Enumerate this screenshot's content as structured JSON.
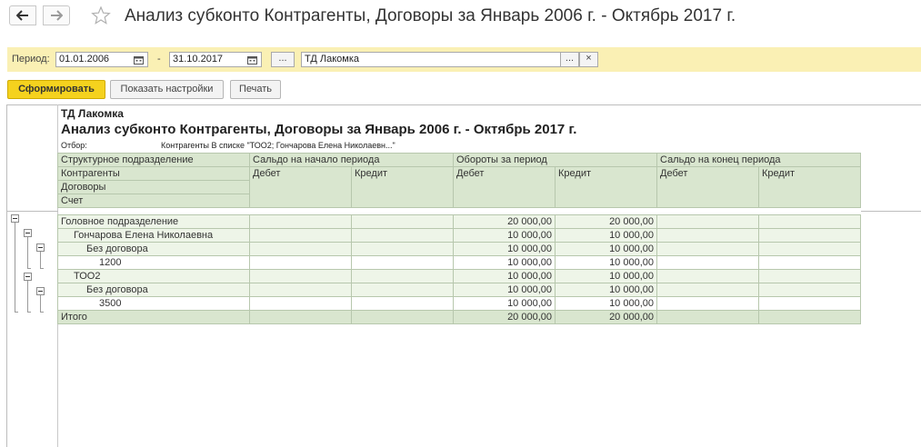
{
  "window": {
    "title": "Анализ субконто Контрагенты, Договоры  за Январь 2006 г. - Октябрь 2017 г.",
    "back_icon": "arrow-left-icon",
    "forward_icon": "arrow-right-icon",
    "favorite_icon": "star-icon"
  },
  "period_panel": {
    "label": "Период:",
    "date_from": "01.01.2006",
    "separator": "-",
    "date_to": "31.10.2017",
    "select_label": "...",
    "organization": "ТД Лакомка",
    "org_select_label": "...",
    "org_clear_label": "×",
    "calendar_icon": "calendar-icon",
    "background": "#faf0b4"
  },
  "toolbar": {
    "form_label": "Сформировать",
    "settings_label": "Показать настройки",
    "print_label": "Печать",
    "accent": "#f5d21e"
  },
  "report": {
    "organization": "ТД Лакомка",
    "title": "Анализ субконто Контрагенты, Договоры  за Январь 2006 г. - Октябрь 2017 г.",
    "filter_label": "Отбор:",
    "filter_value": "Контрагенты В списке \"ТОО2; Гончарова Елена Николаевн...\"",
    "header": {
      "dim1": "Структурное подразделение",
      "dim2": "Контрагенты",
      "dim3": "Договоры",
      "dim4": "Счет",
      "opening": "Сальдо на начало периода",
      "turnover": "Обороты за период",
      "closing": "Сальдо на конец периода",
      "debit": "Дебет",
      "credit": "Кредит"
    },
    "rows": [
      {
        "name": "Головное подразделение",
        "od": "",
        "oc": "",
        "td": "20 000,00",
        "tc": "20 000,00",
        "cd": "",
        "cc": ""
      },
      {
        "name": "Гончарова Елена Николаевна",
        "od": "",
        "oc": "",
        "td": "10 000,00",
        "tc": "10 000,00",
        "cd": "",
        "cc": ""
      },
      {
        "name": "Без договора",
        "od": "",
        "oc": "",
        "td": "10 000,00",
        "tc": "10 000,00",
        "cd": "",
        "cc": ""
      },
      {
        "name": "1200",
        "od": "",
        "oc": "",
        "td": "10 000,00",
        "tc": "10 000,00",
        "cd": "",
        "cc": ""
      },
      {
        "name": "ТОО2",
        "od": "",
        "oc": "",
        "td": "10 000,00",
        "tc": "10 000,00",
        "cd": "",
        "cc": ""
      },
      {
        "name": "Без договора",
        "od": "",
        "oc": "",
        "td": "10 000,00",
        "tc": "10 000,00",
        "cd": "",
        "cc": ""
      },
      {
        "name": "3500",
        "od": "",
        "oc": "",
        "td": "10 000,00",
        "tc": "10 000,00",
        "cd": "",
        "cc": ""
      }
    ],
    "total": {
      "name": "Итого",
      "od": "",
      "oc": "",
      "td": "20 000,00",
      "tc": "20 000,00",
      "cd": "",
      "cc": ""
    }
  }
}
